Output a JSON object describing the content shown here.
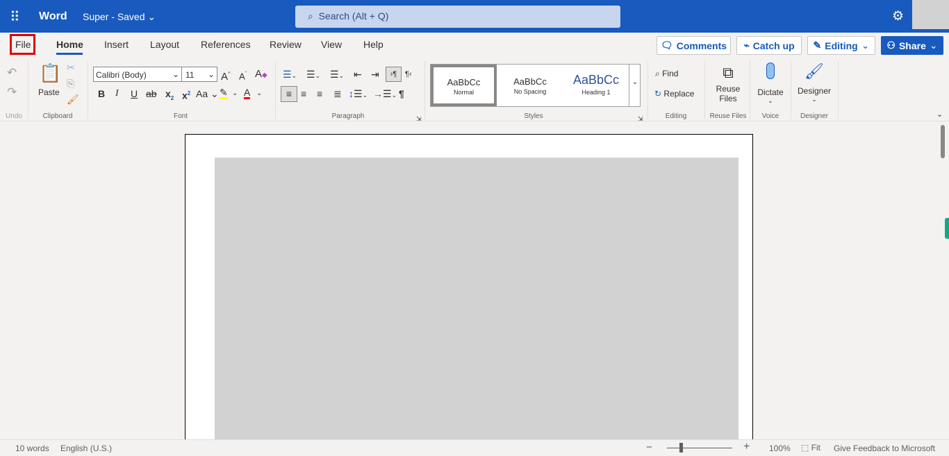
{
  "app": {
    "name": "Word",
    "doc_title": "Super",
    "separator": "-",
    "save_status": "Saved",
    "search_placeholder": "Search (Alt + Q)"
  },
  "tabs": [
    {
      "label": "File",
      "highlighted": true
    },
    {
      "label": "Home",
      "active": true
    },
    {
      "label": "Insert"
    },
    {
      "label": "Layout"
    },
    {
      "label": "References"
    },
    {
      "label": "Review"
    },
    {
      "label": "View"
    },
    {
      "label": "Help"
    }
  ],
  "actions": {
    "comments": "Comments",
    "catch_up": "Catch up",
    "editing": "Editing",
    "share": "Share"
  },
  "ribbon": {
    "undo": {
      "label": "Undo"
    },
    "clipboard": {
      "label": "Clipboard",
      "paste": "Paste"
    },
    "font": {
      "label": "Font",
      "font_name": "Calibri (Body)",
      "font_size": "11",
      "change_case": "Aa"
    },
    "paragraph": {
      "label": "Paragraph"
    },
    "styles": {
      "label": "Styles",
      "items": [
        {
          "sample": "AaBbCc",
          "name": "Normal",
          "selected": true
        },
        {
          "sample": "AaBbCc",
          "name": "No Spacing"
        },
        {
          "sample": "AaBbCc",
          "name": "Heading 1"
        }
      ]
    },
    "editing": {
      "label": "Editing",
      "find": "Find",
      "replace": "Replace"
    },
    "reuse": {
      "label": "Reuse Files",
      "button_line1": "Reuse",
      "button_line2": "Files"
    },
    "voice": {
      "label": "Voice",
      "dictate": "Dictate"
    },
    "designer": {
      "label": "Designer",
      "button": "Designer"
    }
  },
  "status": {
    "words": "10 words",
    "language": "English (U.S.)",
    "zoom": "100%",
    "zoom_level_percent": 100,
    "fit": "Fit",
    "feedback": "Give Feedback to Microsoft"
  },
  "colors": {
    "brand": "#185abd",
    "highlight": "#ffff00",
    "font_color": "#ff0000",
    "file_outline": "#e00000"
  }
}
